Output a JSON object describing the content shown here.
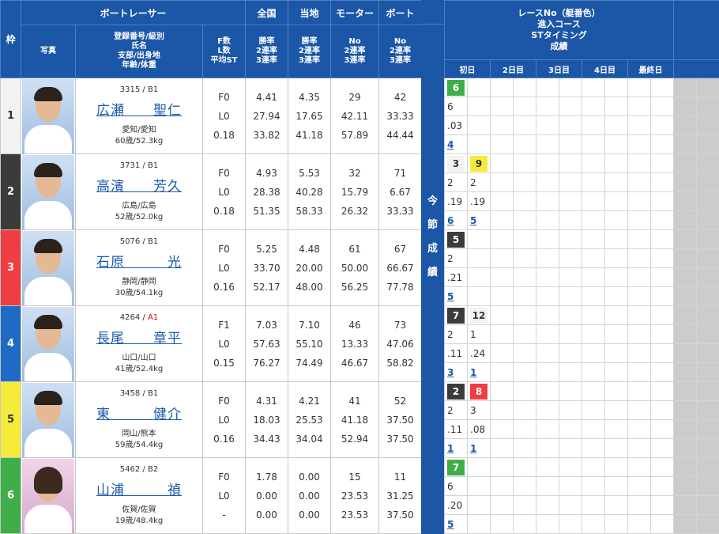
{
  "header": {
    "waku": "枠",
    "racer": "ボートレーサー",
    "national": "全国",
    "local": "当地",
    "motor": "モーター",
    "boat": "ボート",
    "photo": "写真",
    "info_l1": "登録番号/級別",
    "info_l2": "氏名",
    "info_l3": "支部/出身地",
    "info_l4": "年齢/体重",
    "fl_l1": "F数",
    "fl_l2": "L数",
    "fl_l3": "平均ST",
    "rate_l1": "勝率",
    "rate_l2": "2連率",
    "rate_l3": "3連率",
    "no_l1": "No",
    "no_l2": "2連率",
    "no_l3": "3連率"
  },
  "series_header": {
    "l1": "レースNo（艇番色）",
    "l2": "進入コース",
    "l3": "STタイミング",
    "l4": "成績",
    "days": [
      "初日",
      "2日目",
      "3日目",
      "4日目",
      "最終日"
    ]
  },
  "band_text": [
    "今",
    "節",
    "成",
    "績"
  ],
  "racers": [
    {
      "waku": "1",
      "reg": "3315",
      "cls": "B1",
      "name": "広瀬　　聖仁",
      "from": "愛知/愛知",
      "age": "60歳/52.3kg",
      "gender": "male",
      "f": "F0",
      "l": "L0",
      "st": "0.18",
      "nat": [
        "4.41",
        "27.94",
        "33.82"
      ],
      "loc": [
        "4.35",
        "17.65",
        "41.18"
      ],
      "motor": [
        "29",
        "42.11",
        "57.89"
      ],
      "boat": [
        "42",
        "33.33",
        "44.44"
      ],
      "races": [
        {
          "no": "6",
          "color": 6,
          "course": "6",
          "st": ".03",
          "result": "4"
        }
      ]
    },
    {
      "waku": "2",
      "reg": "3731",
      "cls": "B1",
      "name": "高濱　　芳久",
      "from": "広島/広島",
      "age": "52歳/52.0kg",
      "gender": "male",
      "f": "F0",
      "l": "L0",
      "st": "0.18",
      "nat": [
        "4.93",
        "28.38",
        "51.35"
      ],
      "loc": [
        "5.53",
        "40.28",
        "58.33"
      ],
      "motor": [
        "32",
        "15.79",
        "26.32"
      ],
      "boat": [
        "71",
        "6.67",
        "33.33"
      ],
      "races": [
        {
          "no": "3",
          "color": 1,
          "course": "2",
          "st": ".19",
          "result": "6"
        },
        {
          "no": "9",
          "color": 5,
          "course": "2",
          "st": ".19",
          "result": "5"
        }
      ]
    },
    {
      "waku": "3",
      "reg": "5076",
      "cls": "B1",
      "name": "石原　　　光",
      "from": "静岡/静岡",
      "age": "30歳/54.1kg",
      "gender": "male",
      "f": "F0",
      "l": "L0",
      "st": "0.16",
      "nat": [
        "5.25",
        "33.70",
        "52.17"
      ],
      "loc": [
        "4.48",
        "20.00",
        "48.00"
      ],
      "motor": [
        "61",
        "50.00",
        "56.25"
      ],
      "boat": [
        "67",
        "66.67",
        "77.78"
      ],
      "races": [
        {
          "no": "5",
          "color": 2,
          "course": "2",
          "st": ".21",
          "result": "5"
        }
      ]
    },
    {
      "waku": "4",
      "reg": "4264",
      "cls": "A1",
      "name": "長尾　　章平",
      "from": "山口/山口",
      "age": "41歳/52.4kg",
      "gender": "male",
      "f": "F1",
      "l": "L0",
      "st": "0.15",
      "nat": [
        "7.03",
        "57.63",
        "76.27"
      ],
      "loc": [
        "7.10",
        "55.10",
        "74.49"
      ],
      "motor": [
        "46",
        "13.33",
        "46.67"
      ],
      "boat": [
        "73",
        "47.06",
        "58.82"
      ],
      "races": [
        {
          "no": "7",
          "color": 2,
          "course": "2",
          "st": ".11",
          "result": "3"
        },
        {
          "no": "12",
          "color": 1,
          "course": "1",
          "st": ".24",
          "result": "1"
        }
      ]
    },
    {
      "waku": "5",
      "reg": "3458",
      "cls": "B1",
      "name": "東　　　健介",
      "from": "岡山/熊本",
      "age": "59歳/54.4kg",
      "gender": "male",
      "f": "F0",
      "l": "L0",
      "st": "0.16",
      "nat": [
        "4.31",
        "18.03",
        "34.43"
      ],
      "loc": [
        "4.21",
        "25.53",
        "34.04"
      ],
      "motor": [
        "41",
        "41.18",
        "52.94"
      ],
      "boat": [
        "52",
        "37.50",
        "37.50"
      ],
      "races": [
        {
          "no": "2",
          "color": 2,
          "course": "2",
          "st": ".11",
          "result": "1"
        },
        {
          "no": "8",
          "color": 3,
          "course": "3",
          "st": ".08",
          "result": "1"
        }
      ]
    },
    {
      "waku": "6",
      "reg": "5462",
      "cls": "B2",
      "name": "山浦　　　禎",
      "from": "佐賀/佐賀",
      "age": "19歳/48.4kg",
      "gender": "female",
      "f": "F0",
      "l": "L0",
      "st": "-",
      "nat": [
        "1.78",
        "0.00",
        "0.00"
      ],
      "loc": [
        "0.00",
        "0.00",
        "0.00"
      ],
      "motor": [
        "15",
        "23.53",
        "23.53"
      ],
      "boat": [
        "11",
        "31.25",
        "37.50"
      ],
      "races": [
        {
          "no": "7",
          "color": 6,
          "course": "6",
          "st": ".20",
          "result": "5"
        }
      ]
    }
  ]
}
